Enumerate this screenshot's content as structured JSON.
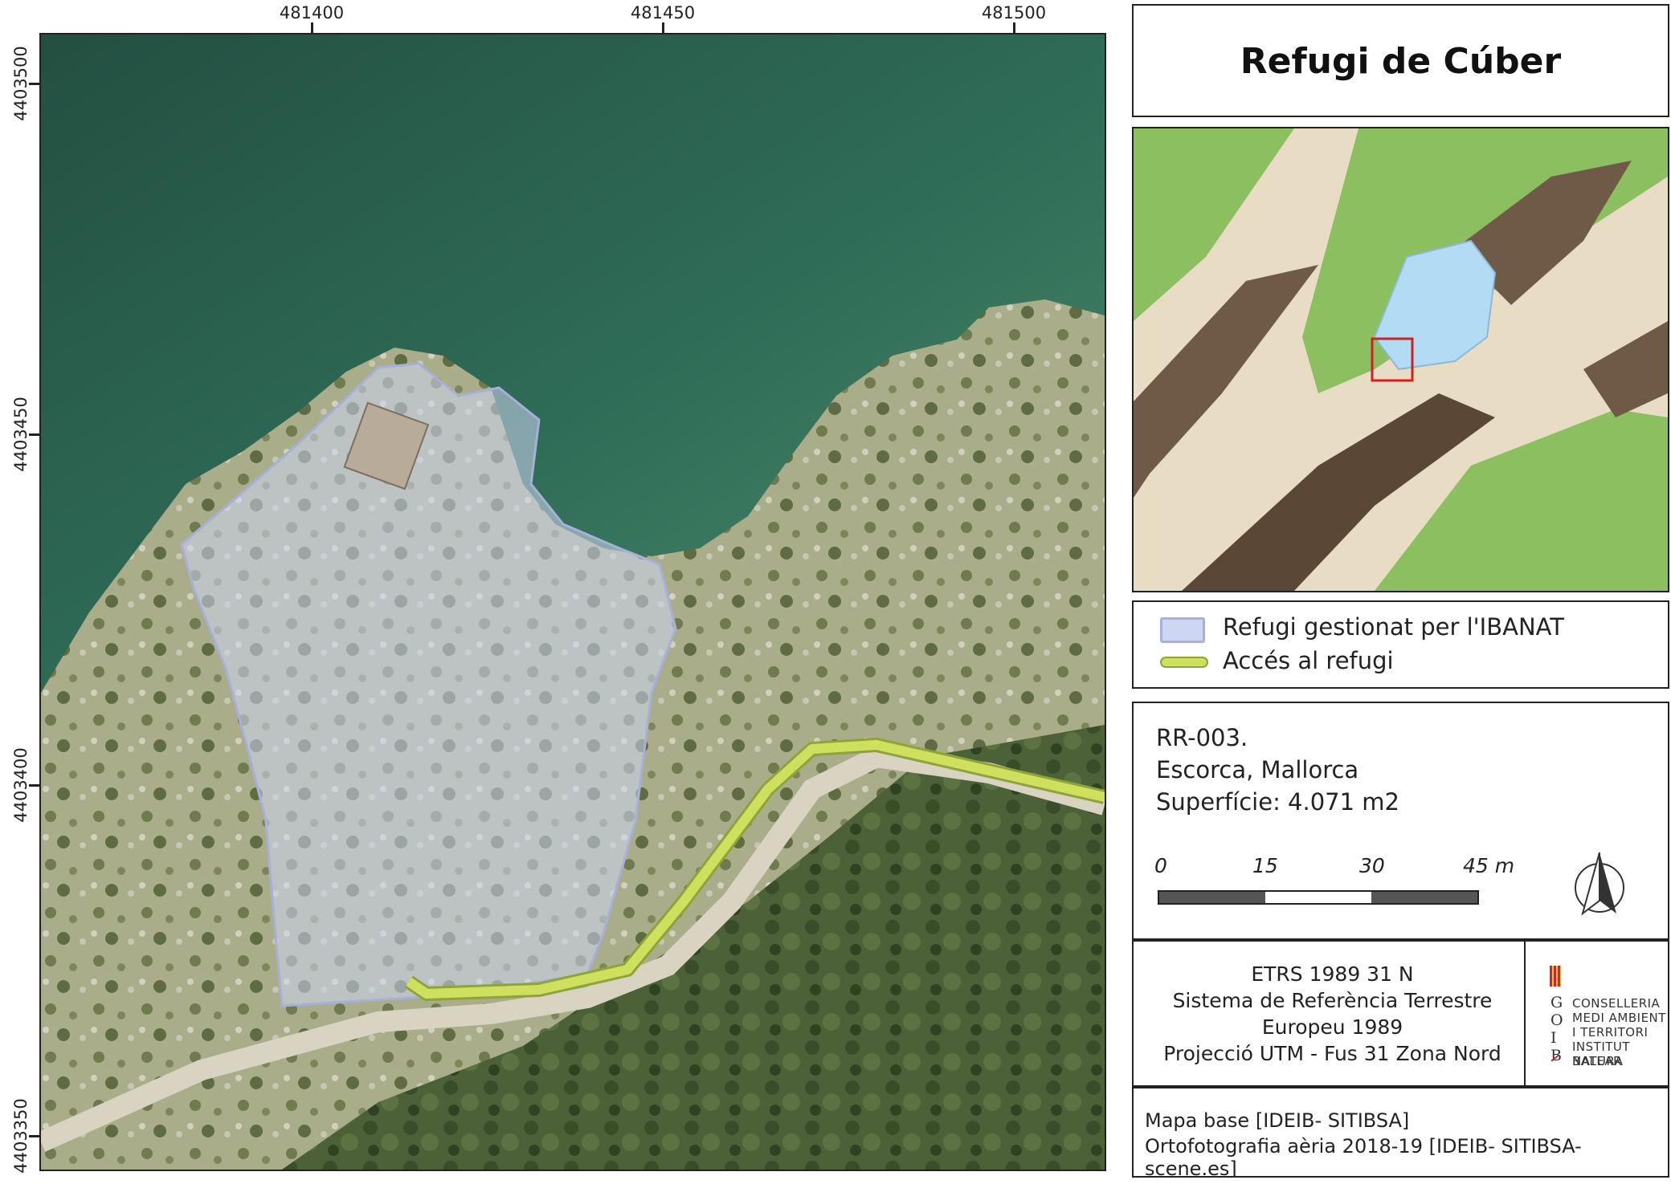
{
  "map": {
    "x_ticks": [
      "481400",
      "481450",
      "481500"
    ],
    "y_ticks": [
      "4403500",
      "4403450",
      "4403400",
      "4403350"
    ]
  },
  "title": "Refugi de Cúber",
  "legend": {
    "items": [
      {
        "label": "Refugi gestionat per l'IBANAT",
        "fill": "#cdd6f2",
        "stroke": "#a7b0d8"
      },
      {
        "label": "Accés al refugi",
        "fill": "#cfe05f",
        "stroke": "#8ea33a"
      }
    ]
  },
  "info": {
    "code": "RR-003.",
    "location": "Escorca, Mallorca",
    "area": "Superfície: 4.071 m2"
  },
  "scale_bar": {
    "labels": [
      "0",
      "15",
      "30",
      "45 m"
    ]
  },
  "crs": {
    "lines": [
      "ETRS 1989 31 N",
      "Sistema de Referència Terrestre",
      "Europeu 1989",
      "Projecció UTM - Fus 31 Zona Nord"
    ]
  },
  "logo": {
    "letters": [
      "G",
      "O",
      "I",
      "B"
    ],
    "lines": [
      "CONSELLERIA",
      "MEDI AMBIENT",
      "I TERRITORI",
      "INSTITUT BALEAR",
      "NATURA"
    ]
  },
  "source": {
    "line1": "Mapa base [IDEIB- SITIBSA]",
    "line2": "Ortofotografia aèria 2018-19 [IDEIB- SITIBSA-scene.es]"
  },
  "colors": {
    "water": "#2d6b56",
    "refuge_fill": "#cdd6f2",
    "path": "#cfe05f",
    "inset_frame": "#d21f1f"
  }
}
